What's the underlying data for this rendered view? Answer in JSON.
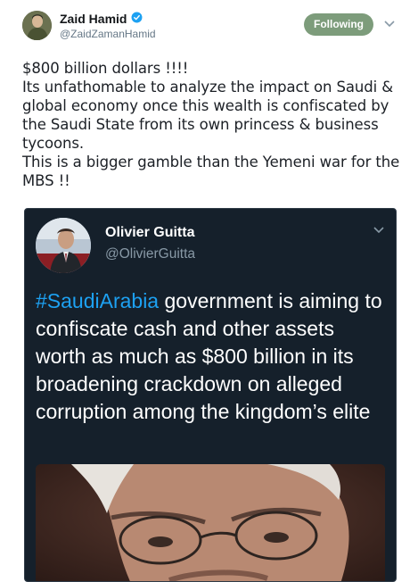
{
  "author": {
    "name": "Zaid Hamid",
    "handle": "@ZaidZamanHamid",
    "verified_icon": "verified-badge-icon"
  },
  "follow_button": {
    "label": "Following",
    "color": "#7d9c7b"
  },
  "tweet": {
    "text": "$800 billion dollars !!!!\nIts unfathomable to analyze the impact on Saudi & global economy once this wealth is confiscated by the Saudi State from its own princess & business tycoons.\nThis is a bigger gamble than the Yemeni war for the MBS !!"
  },
  "quoted_tweet": {
    "name": "Olivier Guitta",
    "handle": "@OlivierGuitta",
    "hashtag": "#SaudiArabia",
    "body": " government is aiming to confiscate cash and other assets worth as much as $800 billion in its broadening crackdown on alleged corruption among the kingdom’s elite",
    "background": "#15202b",
    "hashtag_color": "#1da1f2"
  }
}
